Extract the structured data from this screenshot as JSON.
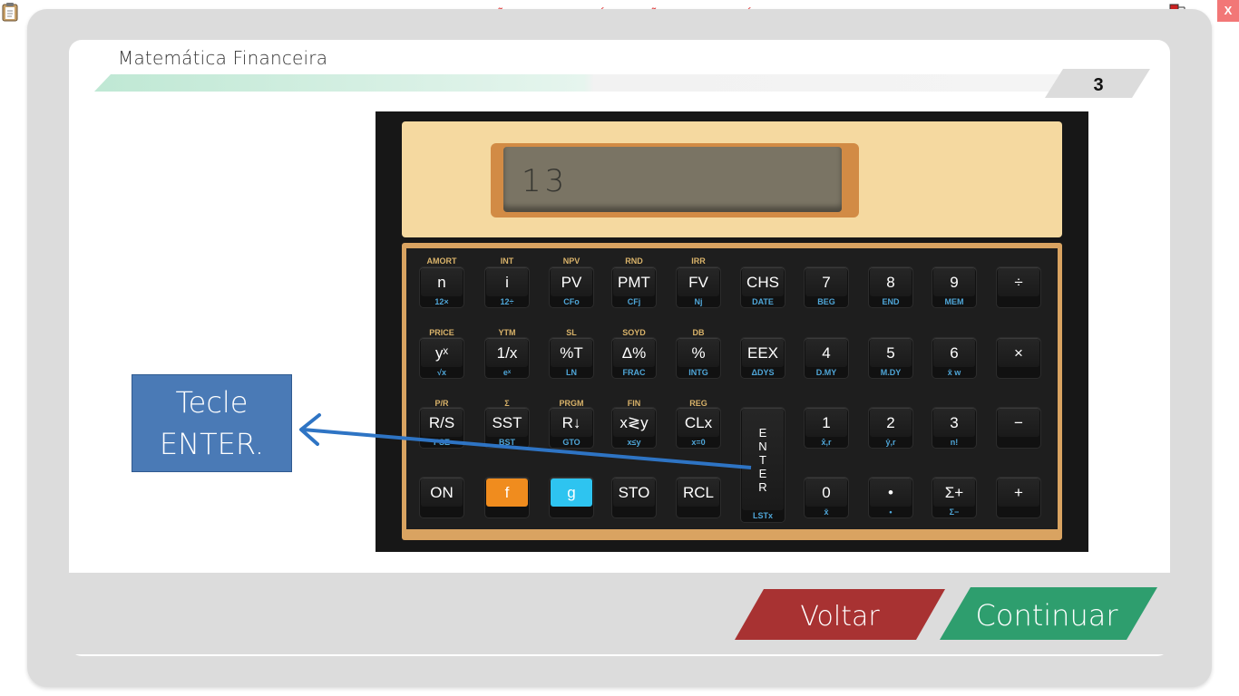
{
  "app": {
    "watermark": "VERSÃO PARA FUNCIONÁRIOS - NÃO COMERCIALIZÁVEL",
    "close_label": "X"
  },
  "page": {
    "title": "Matemática Financeira",
    "page_number": "3"
  },
  "calculator": {
    "display_value": "13",
    "rows": [
      [
        {
          "gold": "AMORT",
          "main": "n",
          "blue": "12×"
        },
        {
          "gold": "INT",
          "main": "i",
          "blue": "12÷"
        },
        {
          "gold": "NPV",
          "main": "PV",
          "blue": "CFo"
        },
        {
          "gold": "RND",
          "main": "PMT",
          "blue": "CFj"
        },
        {
          "gold": "IRR",
          "main": "FV",
          "blue": "Nj"
        },
        {
          "gold": "",
          "main": "CHS",
          "blue": "DATE"
        },
        {
          "gold": "",
          "main": "7",
          "blue": "BEG"
        },
        {
          "gold": "",
          "main": "8",
          "blue": "END"
        },
        {
          "gold": "",
          "main": "9",
          "blue": "MEM"
        },
        {
          "gold": "",
          "main": "÷",
          "blue": ""
        }
      ],
      [
        {
          "gold": "PRICE",
          "main": "yˣ",
          "blue": "√x"
        },
        {
          "gold": "YTM",
          "main": "1/x",
          "blue": "eˣ"
        },
        {
          "gold": "SL",
          "main": "%T",
          "blue": "LN"
        },
        {
          "gold": "SOYD",
          "main": "Δ%",
          "blue": "FRAC"
        },
        {
          "gold": "DB",
          "main": "%",
          "blue": "INTG"
        },
        {
          "gold": "",
          "main": "EEX",
          "blue": "ΔDYS"
        },
        {
          "gold": "",
          "main": "4",
          "blue": "D.MY"
        },
        {
          "gold": "",
          "main": "5",
          "blue": "M.DY"
        },
        {
          "gold": "",
          "main": "6",
          "blue": "x̄ w"
        },
        {
          "gold": "",
          "main": "×",
          "blue": ""
        }
      ],
      [
        {
          "gold": "P/R",
          "main": "R/S",
          "blue": "PSE"
        },
        {
          "gold": "Σ",
          "main": "SST",
          "blue": "BST"
        },
        {
          "gold": "PRGM",
          "main": "R↓",
          "blue": "GTO"
        },
        {
          "gold": "FIN",
          "main": "x≷y",
          "blue": "x≤y"
        },
        {
          "gold": "REG",
          "main": "CLx",
          "blue": "x=0"
        },
        {
          "gold": "",
          "main": "ENTER",
          "blue": "LSTx"
        },
        {
          "gold": "",
          "main": "1",
          "blue": "x̂,r"
        },
        {
          "gold": "",
          "main": "2",
          "blue": "ŷ,r"
        },
        {
          "gold": "",
          "main": "3",
          "blue": "n!"
        },
        {
          "gold": "",
          "main": "−",
          "blue": ""
        }
      ],
      [
        {
          "gold": "",
          "main": "ON",
          "blue": ""
        },
        {
          "gold": "",
          "main": "f",
          "blue": ""
        },
        {
          "gold": "",
          "main": "g",
          "blue": ""
        },
        {
          "gold": "",
          "main": "STO",
          "blue": ""
        },
        {
          "gold": "",
          "main": "RCL",
          "blue": ""
        },
        {
          "gold": "",
          "main": "",
          "blue": ""
        },
        {
          "gold": "",
          "main": "0",
          "blue": "x̄"
        },
        {
          "gold": "",
          "main": "•",
          "blue": "•"
        },
        {
          "gold": "",
          "main": "Σ+",
          "blue": "Σ−"
        },
        {
          "gold": "",
          "main": "+",
          "blue": ""
        }
      ]
    ]
  },
  "callout": {
    "text": "Tecle ENTER."
  },
  "nav": {
    "back_label": "Voltar",
    "next_label": "Continuar"
  },
  "colors": {
    "back": "#a83232",
    "next": "#2e9e6e",
    "callout": "#4a7ab6",
    "calc_body": "#f5d9a0",
    "key_f": "#f08c1e",
    "key_g": "#2ec4f0"
  },
  "icons": [
    "clipboard-icon",
    "network-status-icon",
    "close-icon",
    "arrow-icon"
  ]
}
